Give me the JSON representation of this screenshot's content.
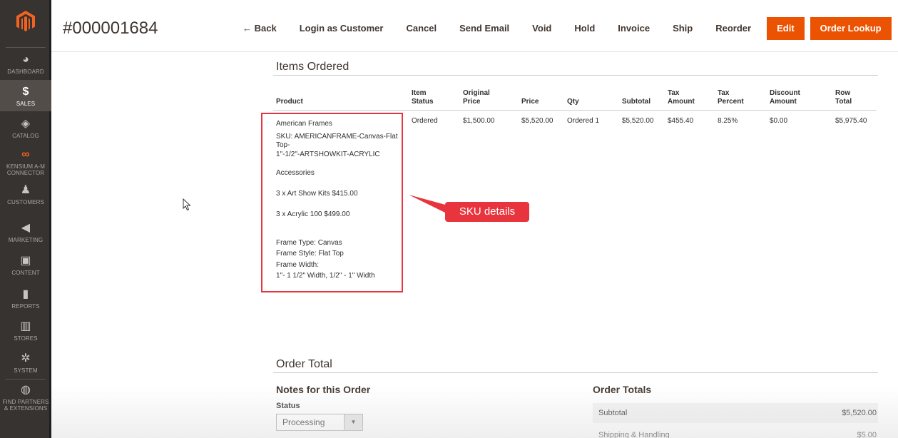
{
  "sidebar": {
    "items": [
      {
        "label": "DASHBOARD",
        "icon": "dashboard-icon",
        "glyph": "◕"
      },
      {
        "label": "SALES",
        "icon": "dollar-icon",
        "glyph": "$"
      },
      {
        "label": "CATALOG",
        "icon": "box-icon",
        "glyph": "◈"
      },
      {
        "label1": "KENSIUM A-M",
        "label2": "CONNECTOR",
        "icon": "infinity-icon",
        "glyph": "∞"
      },
      {
        "label": "CUSTOMERS",
        "icon": "person-icon",
        "glyph": "♟"
      },
      {
        "label": "MARKETING",
        "icon": "megaphone-icon",
        "glyph": "◀"
      },
      {
        "label": "CONTENT",
        "icon": "layout-icon",
        "glyph": "▣"
      },
      {
        "label": "REPORTS",
        "icon": "bar-chart-icon",
        "glyph": "▮"
      },
      {
        "label": "STORES",
        "icon": "store-icon",
        "glyph": "▥"
      },
      {
        "label": "SYSTEM",
        "icon": "gear-icon",
        "glyph": "✲"
      },
      {
        "label1": "FIND PARTNERS",
        "label2": "& EXTENSIONS",
        "icon": "cube-icon",
        "glyph": "◍"
      }
    ]
  },
  "header": {
    "order_number": "#000001684",
    "buttons": {
      "back": "← Back",
      "login": "Login as Customer",
      "cancel": "Cancel",
      "send_email": "Send Email",
      "void": "Void",
      "hold": "Hold",
      "invoice": "Invoice",
      "ship": "Ship",
      "reorder": "Reorder",
      "edit": "Edit",
      "order_lookup": "Order Lookup"
    }
  },
  "items_ordered": {
    "title": "Items Ordered",
    "columns": {
      "product": "Product",
      "item_status_1": "Item",
      "item_status_2": "Status",
      "original_price_1": "Original",
      "original_price_2": "Price",
      "price": "Price",
      "qty": "Qty",
      "subtotal": "Subtotal",
      "tax_amount_1": "Tax",
      "tax_amount_2": "Amount",
      "tax_percent_1": "Tax",
      "tax_percent_2": "Percent",
      "discount_amount_1": "Discount",
      "discount_amount_2": "Amount",
      "row_total_1": "Row",
      "row_total_2": "Total"
    },
    "row": {
      "product_name": "American Frames",
      "sku_line1": "SKU: AMERICANFRAME-Canvas-Flat",
      "sku_line2": "Top-",
      "sku_line3": "1\"-1/2\"-ARTSHOWKIT-ACRYLIC",
      "accessories": "Accessories",
      "acc1": "3 x Art Show Kits $415.00",
      "acc2": "3 x Acrylic 100 $499.00",
      "frame_type": "Frame Type: Canvas",
      "frame_style": "Frame Style: Flat Top",
      "frame_width": "Frame Width:",
      "frame_width_val": "1\"- 1 1/2\" Width, 1/2\" - 1\" Width",
      "item_status": "Ordered",
      "original_price": "$1,500.00",
      "price": "$5,520.00",
      "qty": "Ordered 1",
      "subtotal": "$5,520.00",
      "tax_amount": "$455.40",
      "tax_percent": "8.25%",
      "discount_amount": "$0.00",
      "row_total": "$5,975.40"
    }
  },
  "annotation": {
    "callout_text": "SKU details",
    "highlight_color": "#e5353e"
  },
  "order_total": {
    "title": "Order Total",
    "notes_title": "Notes for this Order",
    "status_label": "Status",
    "status_value": "Processing",
    "totals_title": "Order Totals",
    "subtotal_label": "Subtotal",
    "subtotal_value": "$5,520.00",
    "shipping_label": "Shipping & Handling",
    "shipping_value": "$5.00"
  },
  "colors": {
    "sidebar_bg": "#373330",
    "accent": "#eb5202",
    "logo": "#f26322"
  }
}
